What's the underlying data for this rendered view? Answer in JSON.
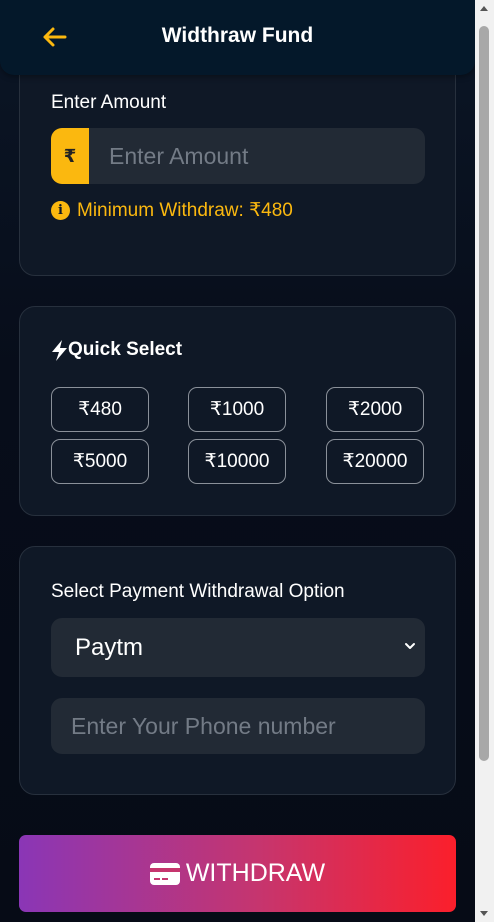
{
  "header": {
    "title": "Widthraw Fund",
    "back_icon": "arrow-left-icon"
  },
  "amount_section": {
    "label": "Enter Amount",
    "currency_symbol": "₹",
    "placeholder": "Enter Amount",
    "min_note": "Minimum Withdraw: ₹480"
  },
  "quick_select": {
    "title": "Quick Select",
    "icon": "lightning-bolt-icon",
    "options": [
      "₹480",
      "₹1000",
      "₹2000",
      "₹5000",
      "₹10000",
      "₹20000"
    ]
  },
  "payment": {
    "label": "Select Payment Withdrawal Option",
    "selected": "Paytm",
    "phone_placeholder": "Enter Your Phone number"
  },
  "withdraw_button": {
    "label": "WITHDRAW",
    "icon": "credit-card-icon"
  },
  "colors": {
    "accent_yellow": "#fbb80f",
    "card_bg": "#0f1826",
    "input_bg": "#222a35",
    "gradient_start": "#8a36b6",
    "gradient_end": "#fb1f2b"
  }
}
